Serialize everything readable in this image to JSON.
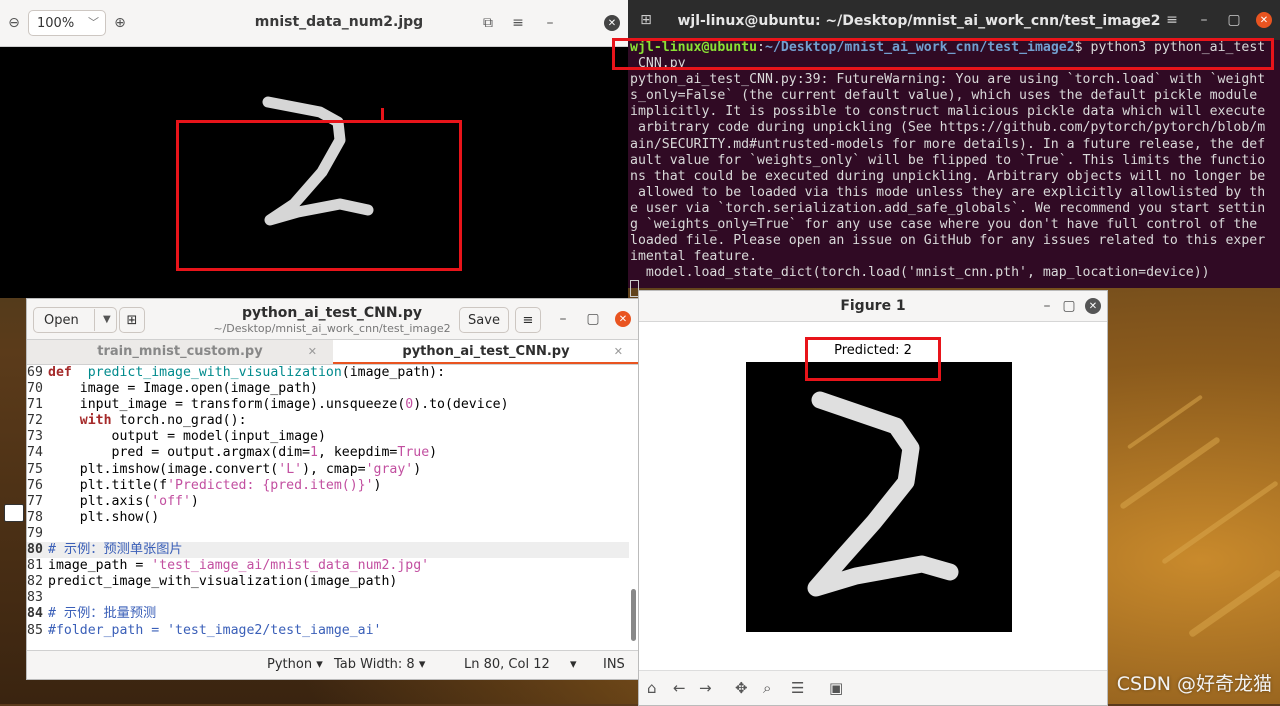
{
  "viewer": {
    "zoom": "100%",
    "title": "mnist_data_num2.jpg"
  },
  "terminal": {
    "title": "wjl-linux@ubuntu: ~/Desktop/mnist_ai_work_cnn/test_image2",
    "prompt_user": "wjl-linux@ubuntu",
    "prompt_sep": ":",
    "prompt_path": "~/Desktop/mnist_ai_work_cnn/test_image2",
    "prompt_cmd": "$ python3 python_ai_test",
    "lines": [
      " CNN.py",
      "python_ai_test_CNN.py:39: FutureWarning: You are using `torch.load` with `weight",
      "s_only=False` (the current default value), which uses the default pickle module",
      "implicitly. It is possible to construct malicious pickle data which will execute",
      " arbitrary code during unpickling (See https://github.com/pytorch/pytorch/blob/m",
      "ain/SECURITY.md#untrusted-models for more details). In a future release, the def",
      "ault value for `weights_only` will be flipped to `True`. This limits the functio",
      "ns that could be executed during unpickling. Arbitrary objects will no longer be",
      " allowed to be loaded via this mode unless they are explicitly allowlisted by th",
      "e user via `torch.serialization.add_safe_globals`. We recommend you start settin",
      "g `weights_only=True` for any use case where you don't have full control of the",
      "loaded file. Please open an issue on GitHub for any issues related to this exper",
      "imental feature.",
      "  model.load_state_dict(torch.load('mnist_cnn.pth', map_location=device))"
    ]
  },
  "gedit": {
    "open_label": "Open",
    "save_label": "Save",
    "file_title": "python_ai_test_CNN.py",
    "file_path": "~/Desktop/mnist_ai_work_cnn/test_image2",
    "tabs": [
      {
        "label": "train_mnist_custom.py"
      },
      {
        "label": "python_ai_test_CNN.py"
      }
    ],
    "status": {
      "language": "Python",
      "tab_width": "Tab Width: 8",
      "position": "Ln 80, Col 12",
      "mode": "INS"
    }
  },
  "code_lines": [
    {
      "n": "69",
      "parts": [
        [
          "kw",
          "def"
        ],
        [
          "",
          "  "
        ],
        [
          "fn",
          "predict_image_with_visualization"
        ],
        [
          "",
          "(image_path):"
        ]
      ]
    },
    {
      "n": "70",
      "parts": [
        [
          "",
          "    image = Image.open(image_path)"
        ]
      ]
    },
    {
      "n": "71",
      "parts": [
        [
          "",
          "    input_image = transform(image).unsqueeze("
        ],
        [
          "num",
          "0"
        ],
        [
          "",
          ").to(device)"
        ]
      ]
    },
    {
      "n": "72",
      "parts": [
        [
          "",
          "    "
        ],
        [
          "kw",
          "with"
        ],
        [
          "",
          " torch.no_grad():"
        ]
      ]
    },
    {
      "n": "73",
      "parts": [
        [
          "",
          "        output = model(input_image)"
        ]
      ]
    },
    {
      "n": "74",
      "parts": [
        [
          "",
          "        pred = output.argmax(dim="
        ],
        [
          "num",
          "1"
        ],
        [
          "",
          ", keepdim="
        ],
        [
          "num",
          "True"
        ],
        [
          "",
          ")"
        ]
      ]
    },
    {
      "n": "75",
      "parts": [
        [
          "",
          "    plt.imshow(image.convert("
        ],
        [
          "str",
          "'L'"
        ],
        [
          "",
          "), cmap="
        ],
        [
          "str",
          "'gray'"
        ],
        [
          "",
          ")"
        ]
      ]
    },
    {
      "n": "76",
      "parts": [
        [
          "",
          "    plt.title(f"
        ],
        [
          "str",
          "'Predicted: {pred.item()}'"
        ],
        [
          "",
          ")"
        ]
      ]
    },
    {
      "n": "77",
      "parts": [
        [
          "",
          "    plt.axis("
        ],
        [
          "str",
          "'off'"
        ],
        [
          "",
          ")"
        ]
      ]
    },
    {
      "n": "78",
      "parts": [
        [
          "",
          "    plt.show()"
        ]
      ]
    },
    {
      "n": "79",
      "parts": [
        [
          "",
          ""
        ]
      ]
    },
    {
      "n": "80",
      "cur": true,
      "parts": [
        [
          "cmt",
          "# 示例：预测单张图片"
        ]
      ]
    },
    {
      "n": "81",
      "parts": [
        [
          "",
          "image_path = "
        ],
        [
          "str",
          "'test_iamge_ai/mnist_data_num2.jpg'"
        ]
      ]
    },
    {
      "n": "82",
      "parts": [
        [
          "",
          "predict_image_with_visualization(image_path)"
        ]
      ]
    },
    {
      "n": "83",
      "parts": [
        [
          "",
          ""
        ]
      ]
    },
    {
      "n": "84",
      "parts": [
        [
          "cmt",
          "# 示例：批量预测"
        ]
      ]
    },
    {
      "n": "85",
      "parts": [
        [
          "cmt",
          "#folder_path = 'test_image2/test_iamge_ai'"
        ]
      ]
    }
  ],
  "figure": {
    "title": "Figure 1",
    "predicted_text": "Predicted: 2"
  },
  "watermark": "CSDN @好奇龙猫"
}
